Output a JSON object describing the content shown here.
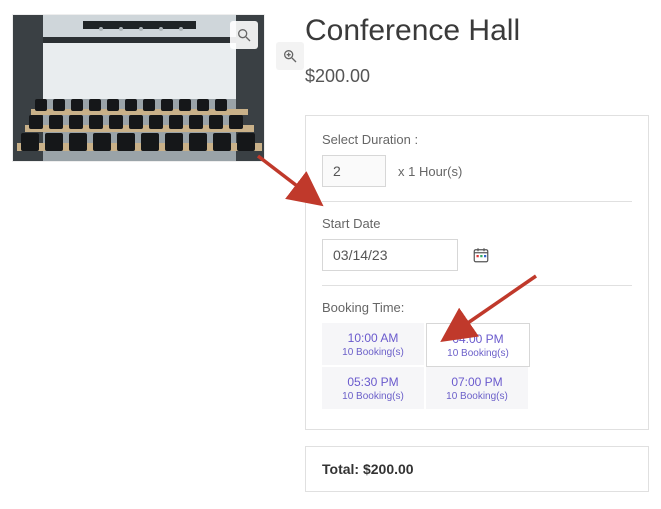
{
  "product": {
    "title": "Conference Hall",
    "price": "$200.00"
  },
  "booking": {
    "duration": {
      "label": "Select Duration :",
      "value": "2",
      "suffix": "x 1 Hour(s)"
    },
    "start_date": {
      "label": "Start Date",
      "value": "03/14/23"
    },
    "time": {
      "label": "Booking Time:",
      "slots": [
        {
          "time": "10:00 AM",
          "count": "10 Booking(s)",
          "selected": false
        },
        {
          "time": "04:00 PM",
          "count": "10 Booking(s)",
          "selected": true
        },
        {
          "time": "05:30 PM",
          "count": "10 Booking(s)",
          "selected": false
        },
        {
          "time": "07:00 PM",
          "count": "10 Booking(s)",
          "selected": false
        }
      ]
    }
  },
  "total": {
    "label": "Total: ",
    "amount": "$200.00"
  },
  "icons": {
    "zoom": "magnify",
    "calendar": "calendar"
  },
  "annotations": {
    "arrow_color": "#c0392b"
  }
}
